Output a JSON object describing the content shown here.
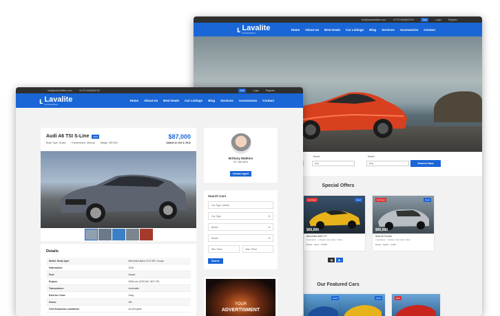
{
  "colors": {
    "primary": "#1a66d6",
    "dark": "#2f2f2f",
    "red": "#d33333"
  },
  "back": {
    "topbar": {
      "email": "info@autoinfolites.com",
      "phone": "+4775 4999800799",
      "sell": "Sell",
      "login": "Login",
      "register": "Register"
    },
    "logo": {
      "name": "Lavalite",
      "tagline": "Automobiles"
    },
    "menu": [
      "Home",
      "About Us",
      "Best Deals",
      "Car Listings",
      "Blog",
      "Services",
      "Accessories",
      "Contact"
    ],
    "search": {
      "brand_label": "Brand",
      "model_label": "Model",
      "brand_value": "Any",
      "model_value": "Any",
      "first_value": "Any",
      "button": "Search Now"
    },
    "special_title": "Special Offers",
    "offers": [
      {
        "tag": "Hot Deal",
        "tag2": "Used",
        "price": "$65,000",
        "name": "Mercedes AMG GT",
        "sub": "6 cylinders · 4 Seats, Automatic, Yellow",
        "meta": "Diesel · Sport · 75,000"
      },
      {
        "tag": "Hot Deal",
        "tag2": "Used",
        "price": "$95,000",
        "name": "Audi A4 Sroche",
        "sub": "4 cylinders · 4 Seats, Automatic, Silver",
        "meta": "Diesel · Sedan · 3,000"
      }
    ],
    "featured_title": "Our Featured Cars",
    "featured_tags": [
      "Used",
      "Used",
      "New"
    ]
  },
  "front": {
    "topbar": {
      "email": "info@autoinfolites.com",
      "phone": "+4775 4999800799",
      "sell": "Sell",
      "login": "Login",
      "register": "Register"
    },
    "logo": {
      "name": "Lavalite",
      "tagline": "Automobiles"
    },
    "menu": [
      "Home",
      "About Us",
      "Best Deals",
      "Car Listings",
      "Blog",
      "Services",
      "Accessories",
      "Contact"
    ],
    "listing": {
      "title": "Audi A6 TSI S-Line",
      "badge": "NEW",
      "price": "$87,000",
      "added": "Added on Oct 3, 2012",
      "body_type": "Body Type: Sedan",
      "transmission": "Transmission: Manual",
      "mileage": "Milage: 450,000"
    },
    "details_title": "Details",
    "specs": [
      [
        "Model, Body type:",
        "Mercedes-Benz CLS 320, Coupe"
      ],
      [
        "Fabrication:",
        "2010"
      ],
      [
        "Fuel:",
        "Diesel"
      ],
      [
        "Engine:",
        "2000 cm³ (275 KW / 507 CP)"
      ],
      [
        "Transmision:",
        "Automatic"
      ],
      [
        "Exterior Color:",
        "Gray"
      ],
      [
        "Doors:",
        "4/5"
      ],
      [
        "CO2-Emissions combined:",
        "ca.423 g/km"
      ]
    ],
    "agent": {
      "name": "Brittany Watkins",
      "phone": "017 456 9874",
      "button": "Contact Agent"
    },
    "search": {
      "title": "Search Cars",
      "car_type_model": "Car Type, Model",
      "car_type": "Car Type",
      "brand": "Brand",
      "model": "Model",
      "min_price": "Min. Price",
      "max_price": "Max. Price",
      "button": "Search"
    },
    "ad": {
      "line1": "YOUR",
      "line2": "ADVERTISMENT"
    }
  }
}
